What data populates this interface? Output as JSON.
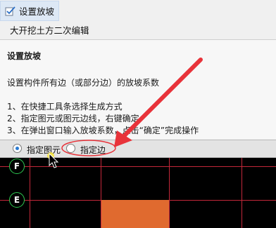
{
  "menu": {
    "set_slope": "设置放坡",
    "earthwork_edit": "大开挖土方二次编辑"
  },
  "tooltip": {
    "title": "设置放坡",
    "description": "设置构件所有边（或部分边）的放坡系数",
    "steps": [
      "1、在快捷工具条选择生成方式",
      "2、指定图元或图元边线，右键确定",
      "3、在弹出窗口输入放坡系数，点击“确定”完成操作"
    ]
  },
  "options": {
    "specify_element": "指定图元",
    "specify_edge": "指定边",
    "selected": "指定图元"
  },
  "canvas": {
    "axis_labels": [
      "F",
      "E"
    ]
  },
  "colors": {
    "grid": "#c4283a",
    "slab": "#e06a2f",
    "axis_marker": "#2ecb52",
    "annotation": "#e8333a"
  }
}
